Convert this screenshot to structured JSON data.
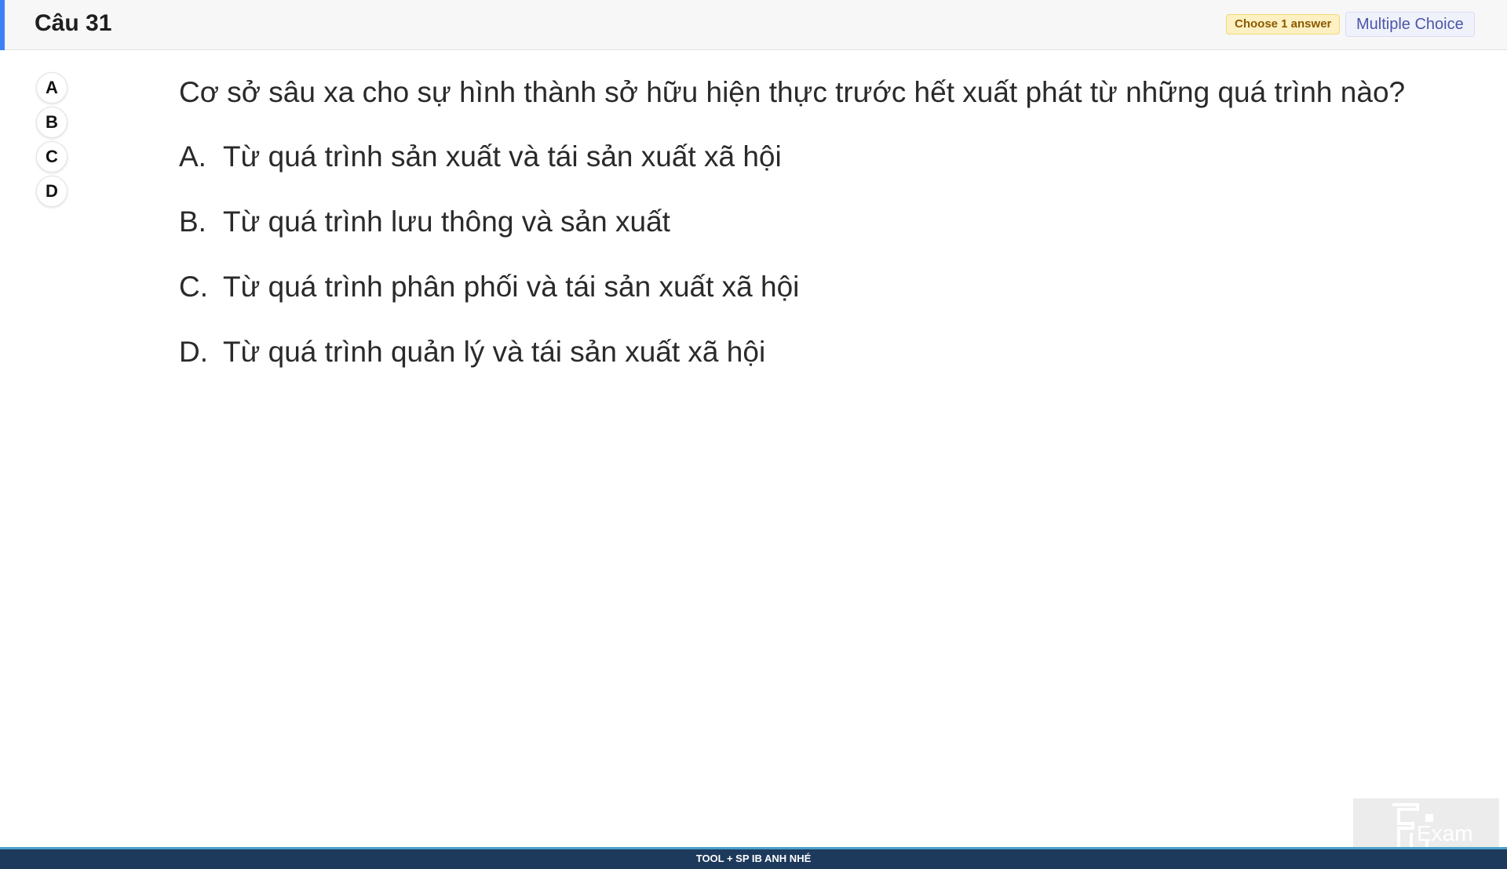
{
  "header": {
    "title": "Câu 31",
    "choose_badge": "Choose 1 answer",
    "type_badge": "Multiple Choice",
    "accent_color": "#3b82f6"
  },
  "option_circles": [
    "A",
    "B",
    "C",
    "D"
  ],
  "question": {
    "text": "Cơ sở sâu xa cho sự hình thành sở hữu hiện thực trước hết xuất phát từ những quá trình nào?",
    "answers": [
      {
        "letter": "A.",
        "text": "Từ quá trình sản xuất và tái sản xuất xã hội"
      },
      {
        "letter": "B.",
        "text": "Từ quá trình lưu thông và sản xuất"
      },
      {
        "letter": "C.",
        "text": "Từ quá trình phân phối và tái sản xuất xã hội"
      },
      {
        "letter": "D.",
        "text": "Từ quá trình quản lý và tái sản xuất xã hội"
      }
    ]
  },
  "logo": {
    "text": "Exam",
    "icon": "fu-exam-logo-icon"
  },
  "footer": {
    "text": "TOOL + SP IB ANH NHÉ",
    "color": "#1d3a5c"
  }
}
